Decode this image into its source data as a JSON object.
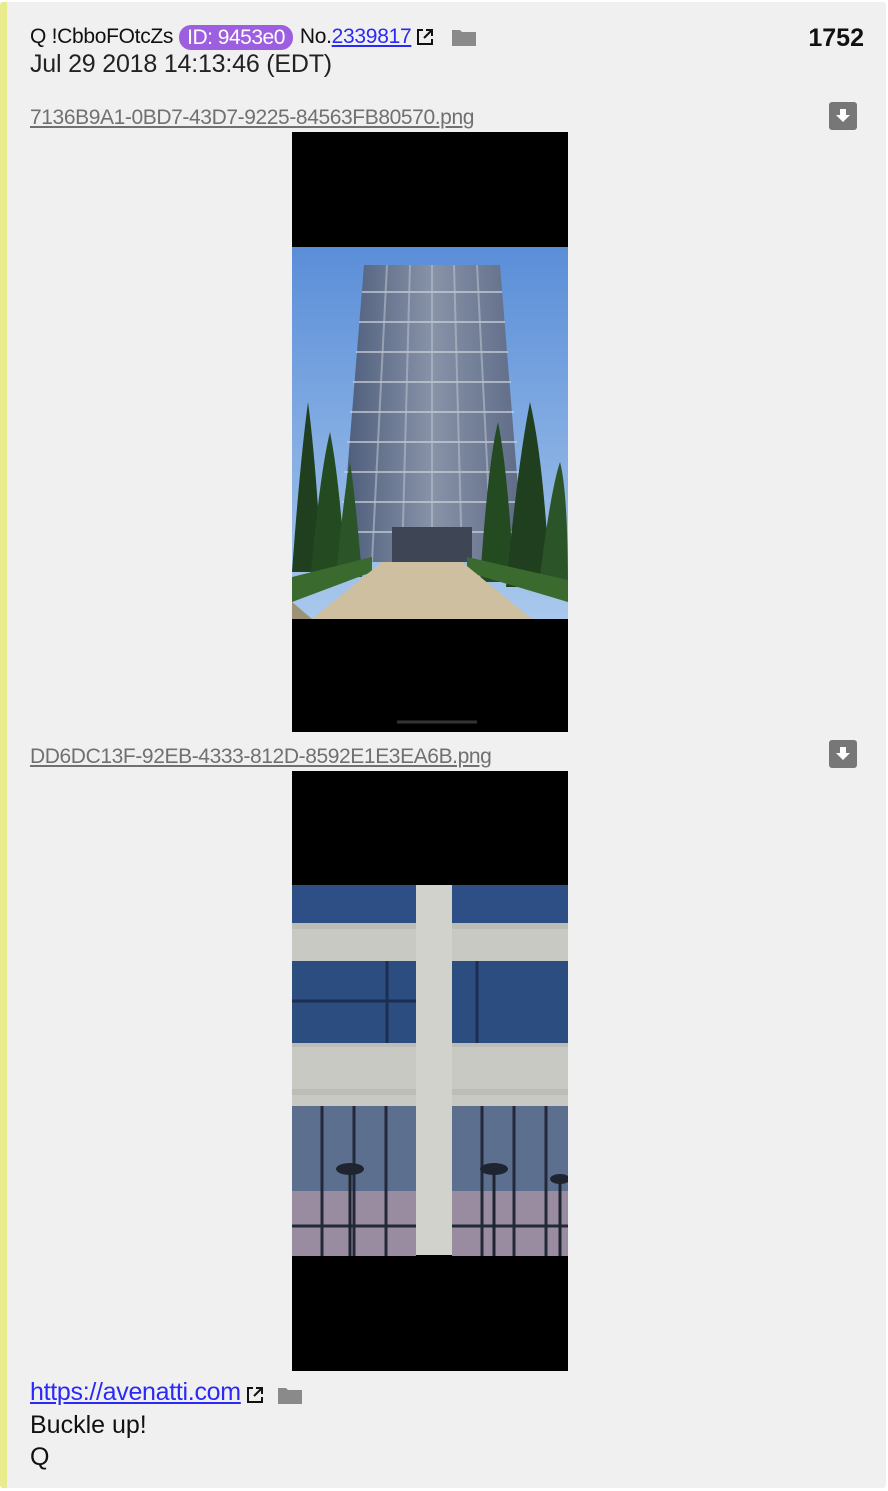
{
  "post": {
    "author": "Q !CbboFOtcZs",
    "id_badge": "ID: 9453e0",
    "no_label": "No.",
    "post_id": "2339817",
    "post_number": "1752",
    "timestamp": "Jul 29 2018 14:13:46 (EDT)",
    "badge_color": "#9d5fe0",
    "link_color": "#2a2af5",
    "accent_border_color": "#e8ec8c"
  },
  "files": [
    {
      "name": "7136B9A1-0BD7-43D7-9225-84563FB80570.png",
      "image_subject": "tall office tower with cypress trees under blue sky"
    },
    {
      "name": "DD6DC13F-92EB-4333-812D-8592E1E3EA6B.png",
      "image_subject": "building facade close-up with reflected palm trees"
    }
  ],
  "message": {
    "link_text": "https://avenatti.com",
    "lines": [
      "Buckle up!",
      "Q"
    ]
  },
  "icons": {
    "external_link": "external-link-icon",
    "folder": "folder-icon",
    "download": "download-icon"
  }
}
